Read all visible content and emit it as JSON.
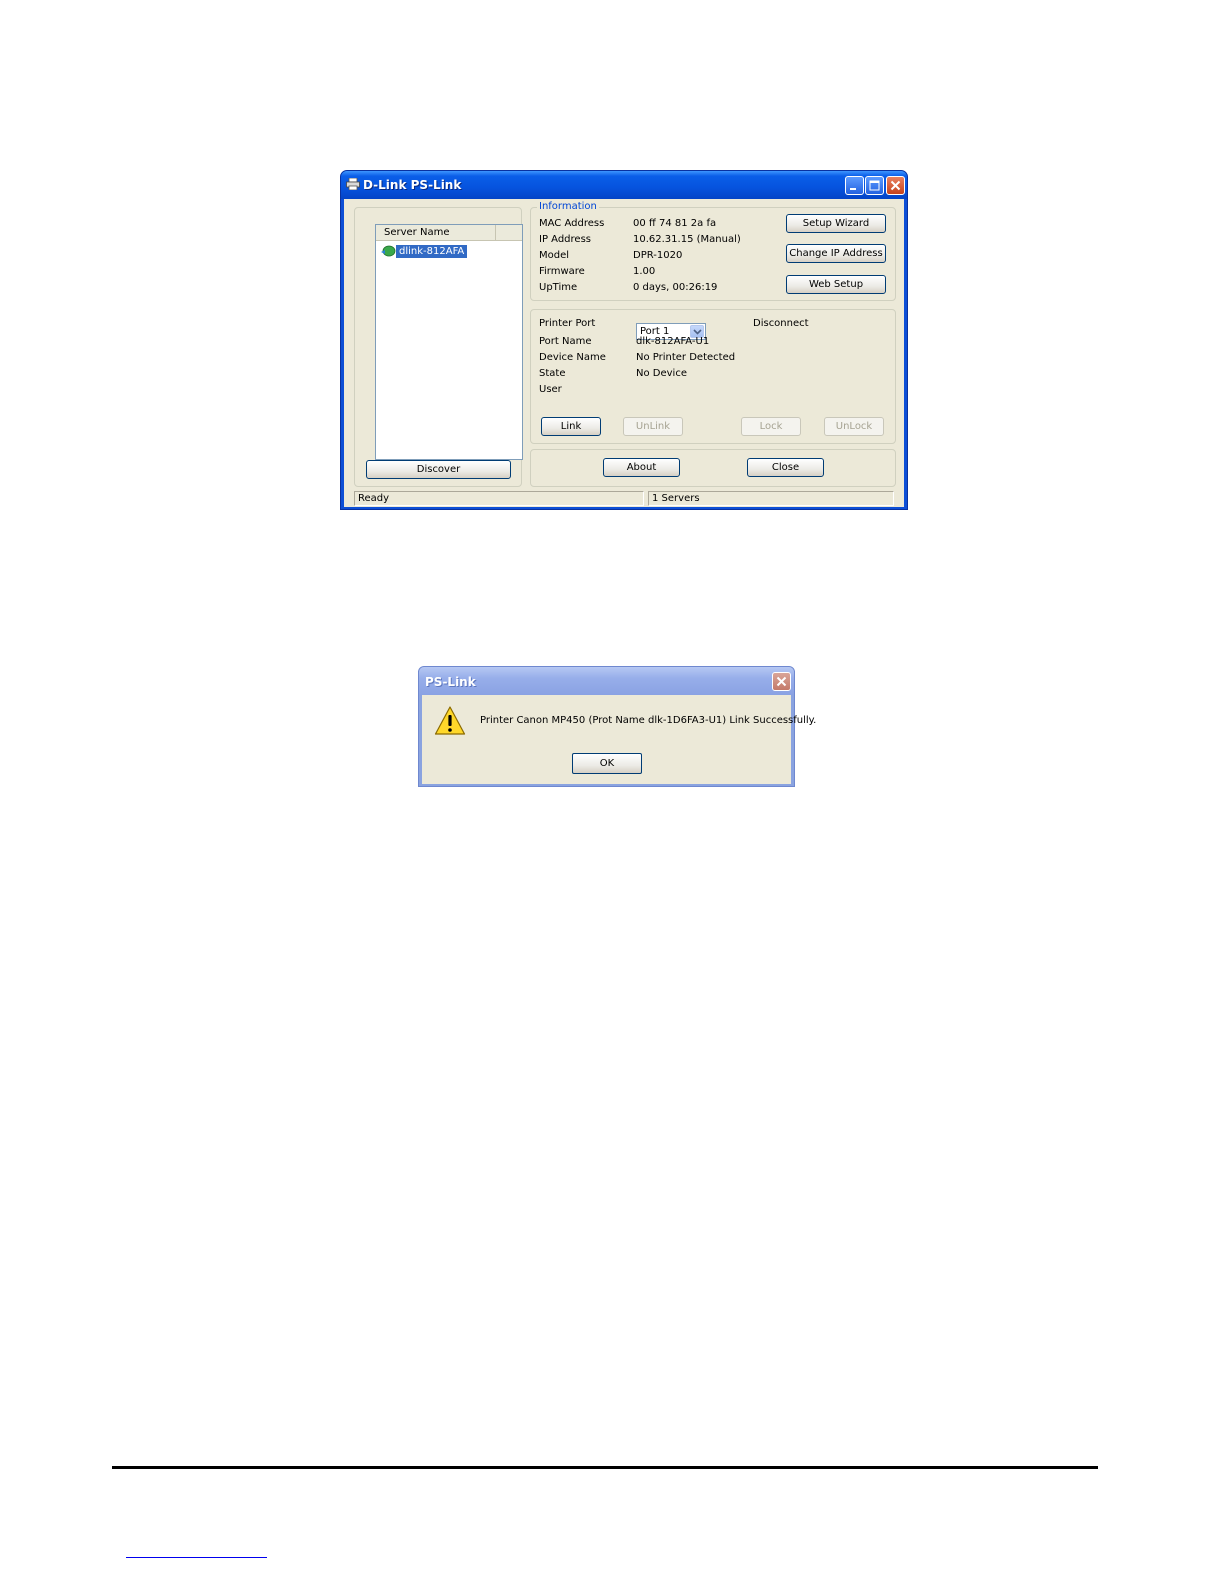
{
  "main_window": {
    "title": "D-Link PS-Link",
    "server_list": {
      "column_header": "Server Name",
      "items": [
        {
          "label": "dlink-812AFA",
          "selected": true
        }
      ],
      "discover_label": "Discover"
    },
    "information": {
      "legend": "Information",
      "fields": [
        {
          "label": "MAC Address",
          "value": "00 ff 74 81 2a fa"
        },
        {
          "label": "IP Address",
          "value": "10.62.31.15 (Manual)"
        },
        {
          "label": "Model",
          "value": "DPR-1020"
        },
        {
          "label": "Firmware",
          "value": "1.00"
        },
        {
          "label": "UpTime",
          "value": "0 days, 00:26:19"
        }
      ],
      "buttons": {
        "setup_wizard": "Setup Wizard",
        "change_ip": "Change IP Address",
        "web_setup": "Web Setup"
      }
    },
    "printer": {
      "port_label": "Printer Port",
      "port_selected": "Port 1",
      "connection_status": "Disconnect",
      "fields": [
        {
          "label": "Port Name",
          "value": "dlk-812AFA-U1"
        },
        {
          "label": "Device Name",
          "value": "No Printer Detected"
        },
        {
          "label": "State",
          "value": "No Device"
        },
        {
          "label": "User",
          "value": ""
        }
      ],
      "buttons": {
        "link": "Link",
        "unlink": "UnLink",
        "lock": "Lock",
        "unlock": "UnLock"
      }
    },
    "footer_buttons": {
      "about": "About",
      "close": "Close"
    },
    "status": {
      "left": "Ready",
      "right": "1 Servers"
    }
  },
  "dialog": {
    "title": "PS-Link",
    "message": "Printer Canon MP450 (Prot Name dlk-1D6FA3-U1) Link Successfully.",
    "ok_label": "OK",
    "icon": "warning-icon"
  },
  "colors": {
    "titlebar": "#0653de",
    "client_bg": "#ece9d8",
    "selection": "#316ac5",
    "group_legend": "#0046d5",
    "dialog_frame": "#8aa3e0"
  }
}
